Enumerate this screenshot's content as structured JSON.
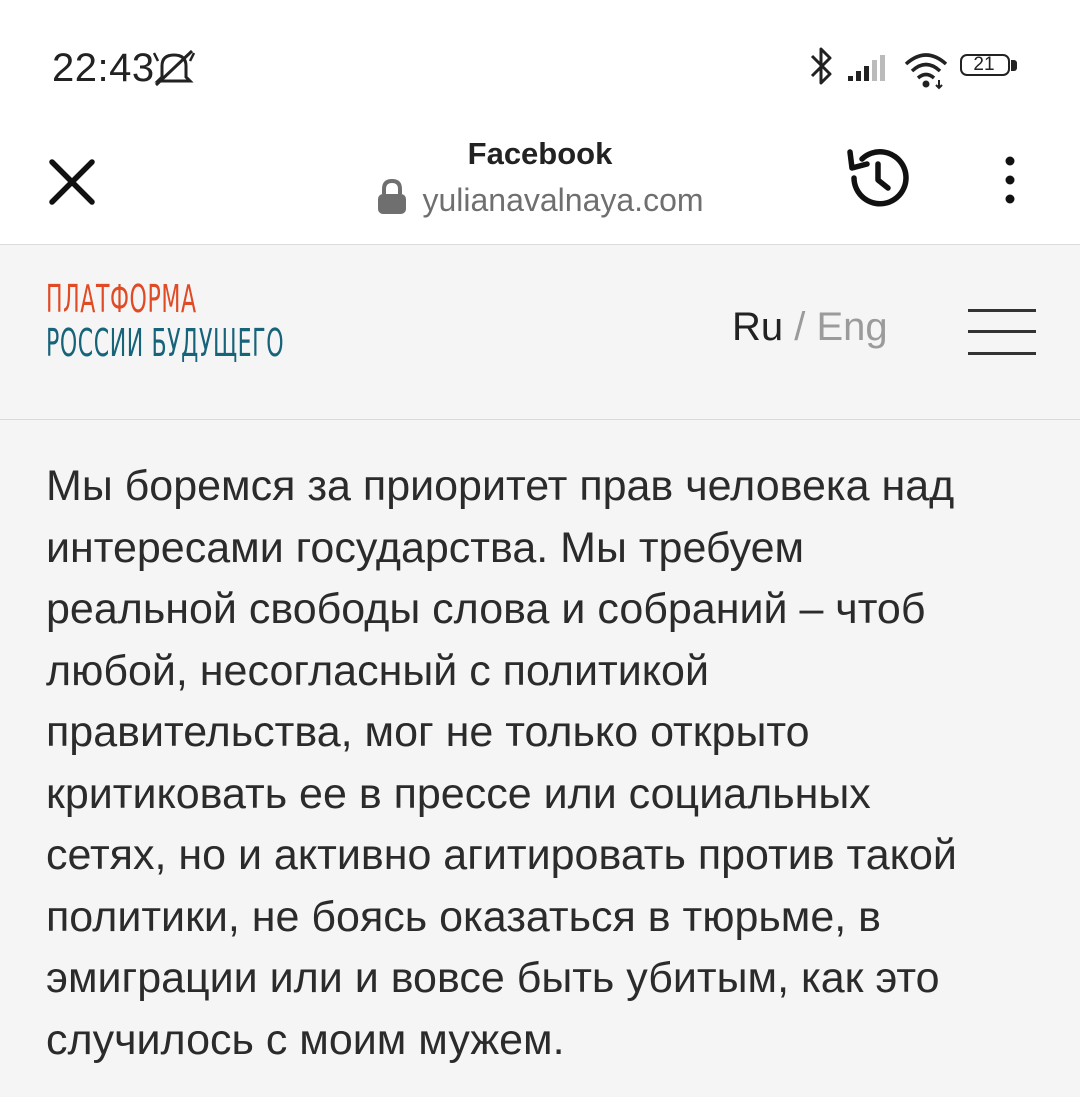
{
  "status_bar": {
    "time": "22:43",
    "battery": "21",
    "icons": [
      "notifications-muted-icon",
      "bluetooth-icon",
      "signal-icon",
      "wifi-icon",
      "battery-icon"
    ]
  },
  "browser": {
    "title": "Facebook",
    "url": "yulianavalnaya.com",
    "icons": [
      "close-icon",
      "lock-icon",
      "history-icon",
      "more-vert-icon"
    ]
  },
  "site": {
    "logo_line1": "ПЛАТФОРМА",
    "logo_line2": "РОССИИ БУДУЩЕГО",
    "lang_ru": "Ru",
    "lang_sep": " / ",
    "lang_eng": "Eng",
    "menu_icon": "hamburger-menu-icon"
  },
  "colors": {
    "logo_orange": "#e04a25",
    "logo_teal": "#17637a",
    "page_bg": "#f5f5f5",
    "text": "#2b2b2b"
  },
  "content": {
    "paragraph": "Мы боремся за приоритет прав человека над\nинтересами государства. Мы требуем\nреальной свободы слова и собраний – чтоб\nлюбой, несогласный с политикой\nправительства, мог не только открыто\nкритиковать ее в прессе или социальных\nсетях, но и активно агитировать против такой\nполитики, не боясь оказаться в тюрьме, в\nэмиграции или и вовсе быть убитым, как это\nслучилось с моим мужем."
  }
}
